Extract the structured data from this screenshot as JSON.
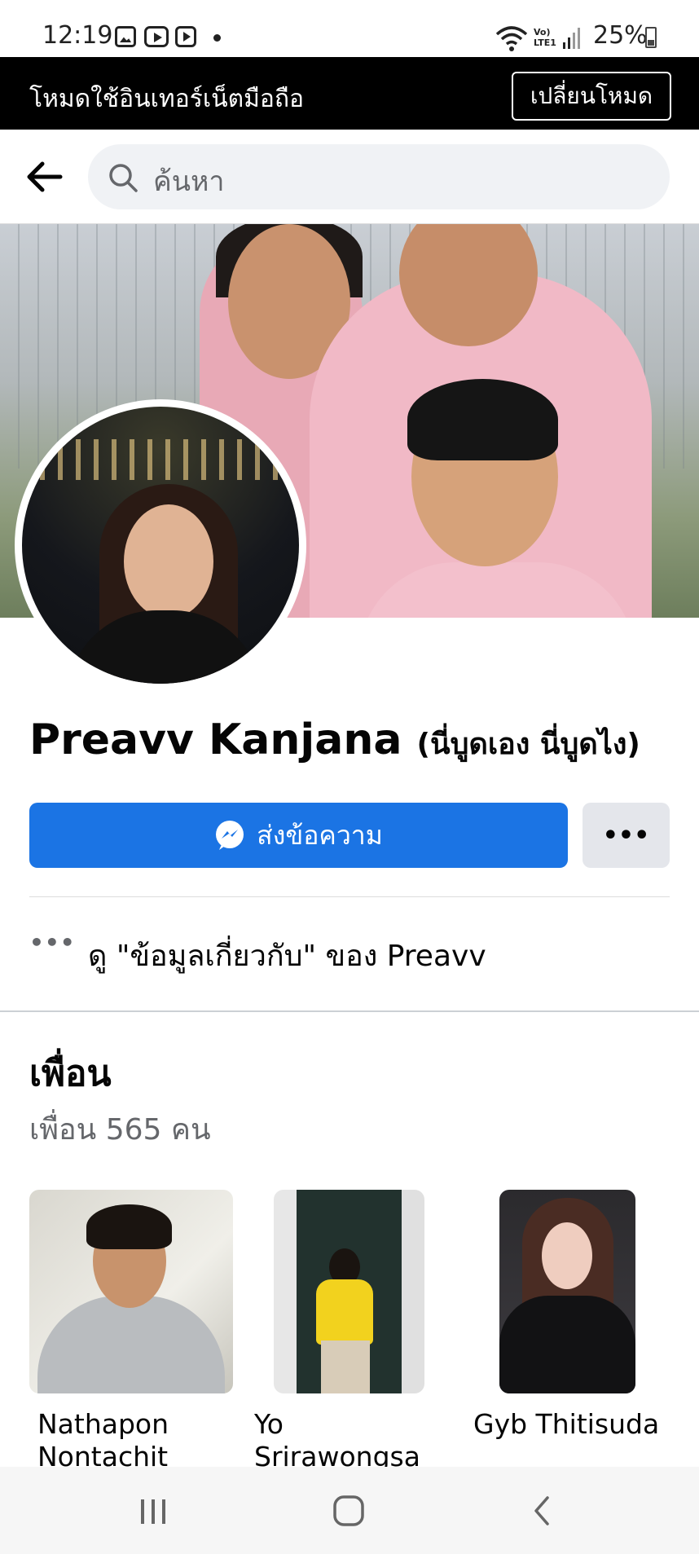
{
  "status_bar": {
    "time": "12:19",
    "lte_line1": "Vo)",
    "lte_line2": "LTE1",
    "battery": "25%"
  },
  "banner": {
    "text": "โหมดใช้อินเทอร์เน็ตมือถือ",
    "button": "เปลี่ยนโหมด"
  },
  "search": {
    "placeholder": "ค้นหา"
  },
  "profile": {
    "name": "Preavv Kanjana",
    "alternate_name": "(นี่บูดเอง นี่บูดไง)",
    "message_button": "ส่งข้อความ",
    "more_button": "•••",
    "about_dots": "•••",
    "about_text": "ดู \"ข้อมูลเกี่ยวกับ\" ของ Preavv"
  },
  "friends": {
    "title": "เพื่อน",
    "count": "เพื่อน 565 คน",
    "items": [
      {
        "name_line1": "Nathapon",
        "name_line2": "Nontachit"
      },
      {
        "name_line1": "Yo",
        "name_line2": "Srirawongsa"
      },
      {
        "name_line1": "Gyb Thitisuda",
        "name_line2": ""
      }
    ]
  },
  "colors": {
    "primary_blue": "#1b74e4",
    "banner_bg": "#000000",
    "secondary_button": "#e4e6eb",
    "muted_text": "#65676b"
  },
  "icons": {
    "status": [
      "gallery-icon",
      "youtube-icon",
      "play-store-icon",
      "wifi-icon",
      "signal-icon",
      "battery-icon"
    ],
    "header": [
      "back-arrow-icon",
      "search-icon"
    ],
    "actions": [
      "messenger-icon"
    ],
    "navigation": [
      "recents-icon",
      "home-icon",
      "back-icon"
    ]
  }
}
